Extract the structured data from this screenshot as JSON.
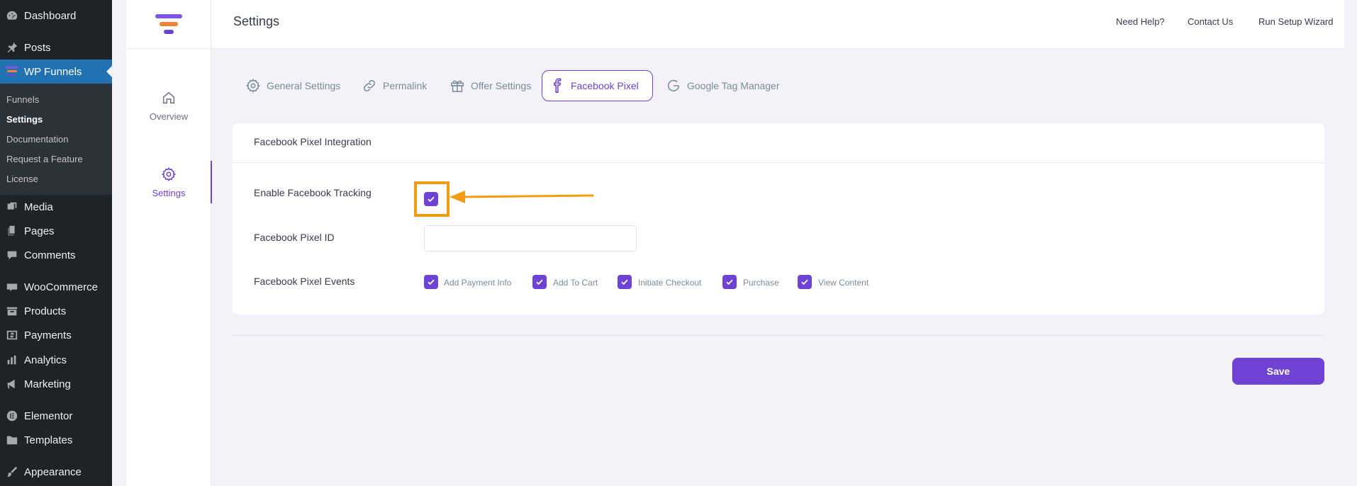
{
  "wp_sidebar": {
    "items": [
      {
        "label": "Dashboard",
        "icon": "dashboard-icon"
      },
      {
        "label": "Posts",
        "icon": "pin-icon"
      },
      {
        "label": "WP Funnels",
        "icon": "wpfunnels-icon"
      },
      {
        "label": "Media",
        "icon": "media-icon"
      },
      {
        "label": "Pages",
        "icon": "pages-icon"
      },
      {
        "label": "Comments",
        "icon": "comments-icon"
      },
      {
        "label": "WooCommerce",
        "icon": "woocommerce-icon"
      },
      {
        "label": "Products",
        "icon": "products-icon"
      },
      {
        "label": "Payments",
        "icon": "payments-icon"
      },
      {
        "label": "Analytics",
        "icon": "analytics-icon"
      },
      {
        "label": "Marketing",
        "icon": "megaphone-icon"
      },
      {
        "label": "Elementor",
        "icon": "elementor-icon"
      },
      {
        "label": "Templates",
        "icon": "folder-icon"
      },
      {
        "label": "Appearance",
        "icon": "brush-icon"
      }
    ],
    "submenu": [
      "Funnels",
      "Settings",
      "Documentation",
      "Request a Feature",
      "License"
    ]
  },
  "header": {
    "title": "Settings",
    "links": [
      "Need Help?",
      "Contact Us",
      "Run Setup Wizard"
    ]
  },
  "left_nav": {
    "overview_label": "Overview",
    "settings_label": "Settings"
  },
  "tabs": [
    {
      "label": "General Settings",
      "icon": "gear-icon"
    },
    {
      "label": "Permalink",
      "icon": "link-icon"
    },
    {
      "label": "Offer Settings",
      "icon": "gift-icon"
    },
    {
      "label": "Facebook Pixel",
      "icon": "facebook-icon"
    },
    {
      "label": "Google Tag Manager",
      "icon": "google-icon"
    }
  ],
  "card": {
    "title": "Facebook Pixel Integration",
    "enable_label": "Enable Facebook Tracking",
    "enable_checked": true,
    "pixel_id_label": "Facebook Pixel ID",
    "pixel_id_value": "",
    "events_label": "Facebook Pixel Events",
    "events": [
      {
        "label": "Add Payment Info",
        "checked": true
      },
      {
        "label": "Add To Cart",
        "checked": true
      },
      {
        "label": "Initiate Checkout",
        "checked": true
      },
      {
        "label": "Purchase",
        "checked": true
      },
      {
        "label": "View Content",
        "checked": true
      }
    ]
  },
  "save_label": "Save",
  "colors": {
    "accent": "#6e42d3",
    "highlight": "#f29c13",
    "wp_sidebar": "#1d2327",
    "wp_active": "#2271b1"
  }
}
